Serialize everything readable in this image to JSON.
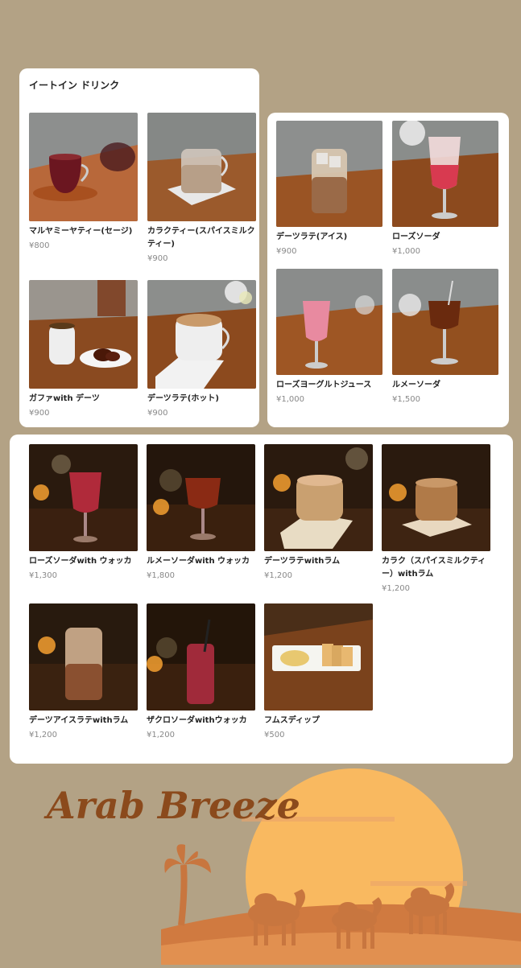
{
  "panel1": {
    "title": "イートイン ドリンク",
    "items": [
      {
        "name": "マルヤミーヤティー(セージ)",
        "price": "¥800"
      },
      {
        "name": "カラクティー(スパイスミルクティー)",
        "price": "¥900"
      },
      {
        "name": "ガファwith デーツ",
        "price": "¥900"
      },
      {
        "name": "デーツラテ(ホット)",
        "price": "¥900"
      }
    ]
  },
  "panel2": {
    "items": [
      {
        "name": "デーツラテ(アイス)",
        "price": "¥900"
      },
      {
        "name": "ローズソーダ",
        "price": "¥1,000"
      },
      {
        "name": "ローズヨーグルトジュース",
        "price": "¥1,000"
      },
      {
        "name": "ルメーソーダ",
        "price": "¥1,500"
      }
    ]
  },
  "panel3": {
    "items": [
      {
        "name": "ローズソーダwith ウォッカ",
        "price": "¥1,300"
      },
      {
        "name": "ルメーソーダwith ウォッカ",
        "price": "¥1,800"
      },
      {
        "name": "デーツラテwithラム",
        "price": "¥1,200"
      },
      {
        "name": "カラク（スパイスミルクティー）withラム",
        "price": "¥1,200"
      },
      {
        "name": "デーツアイスラテwithラム",
        "price": "¥1,200"
      },
      {
        "name": "ザクロソーダwithウォッカ",
        "price": "¥1,200"
      },
      {
        "name": "フムスディップ",
        "price": "¥500"
      }
    ]
  },
  "brand": {
    "logo": "Arab Breeze",
    "colors": {
      "background": "#b3a285",
      "sun": "#f9b960",
      "logo": "#8b4a1c",
      "silhouette": "#c8763f"
    }
  }
}
